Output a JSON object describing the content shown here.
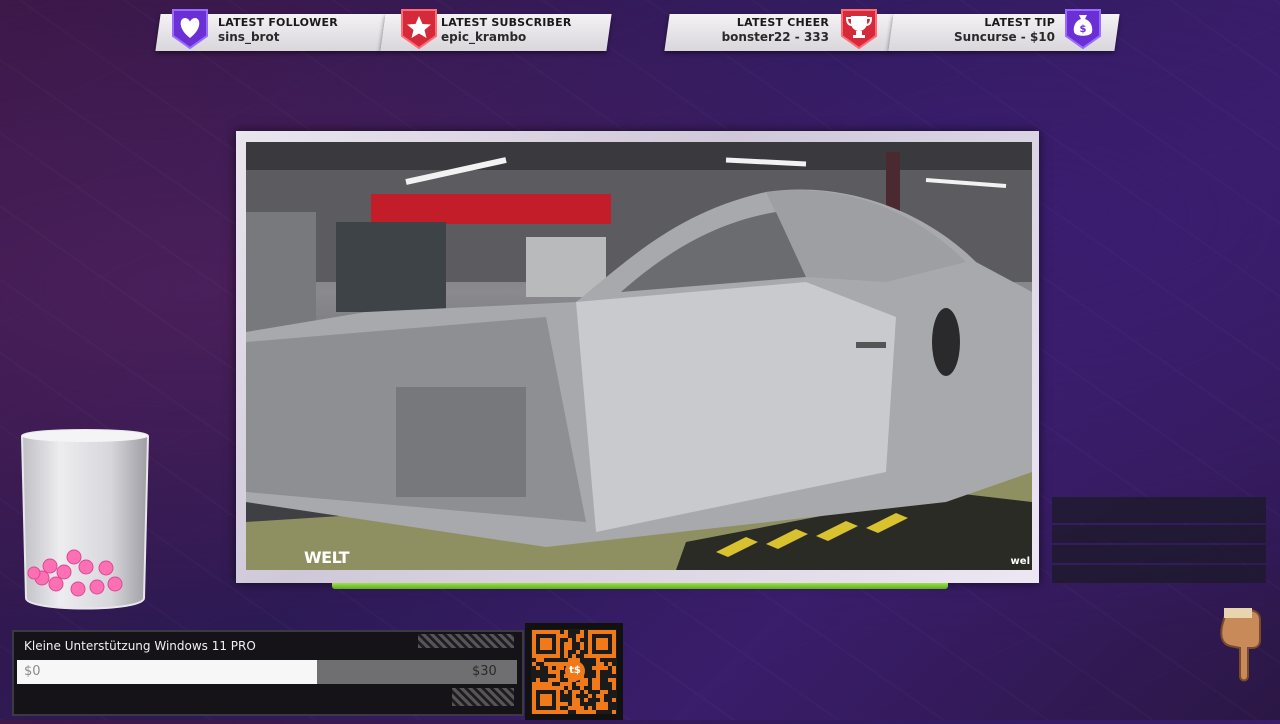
{
  "alerts": {
    "follower": {
      "label": "LATEST FOLLOWER",
      "value": "sins_brot"
    },
    "subscriber": {
      "label": "LATEST SUBSCRIBER",
      "value": "epic_krambo"
    },
    "cheer": {
      "label": "LATEST CHEER",
      "value": "bonster22 - 333"
    },
    "tip": {
      "label": "LATEST TIP",
      "value": "Suncurse - $10"
    }
  },
  "video": {
    "watermark_left": "WELT",
    "watermark_right": "wel"
  },
  "donation_goal": {
    "title": "Kleine Unterstützung Windows 11 PRO",
    "start_amount": "$0",
    "goal_amount": "$30",
    "progress": 0.6
  },
  "qr": {
    "center_label": "t$"
  },
  "colors": {
    "accent_purple": "#6b2fd6",
    "accent_red": "#d42a3a",
    "progress_green": "#7ccf2f"
  },
  "icons": [
    "heart-icon",
    "star-icon",
    "trophy-icon",
    "money-bag-icon",
    "qr-code-icon",
    "pointing-hand-icon"
  ]
}
